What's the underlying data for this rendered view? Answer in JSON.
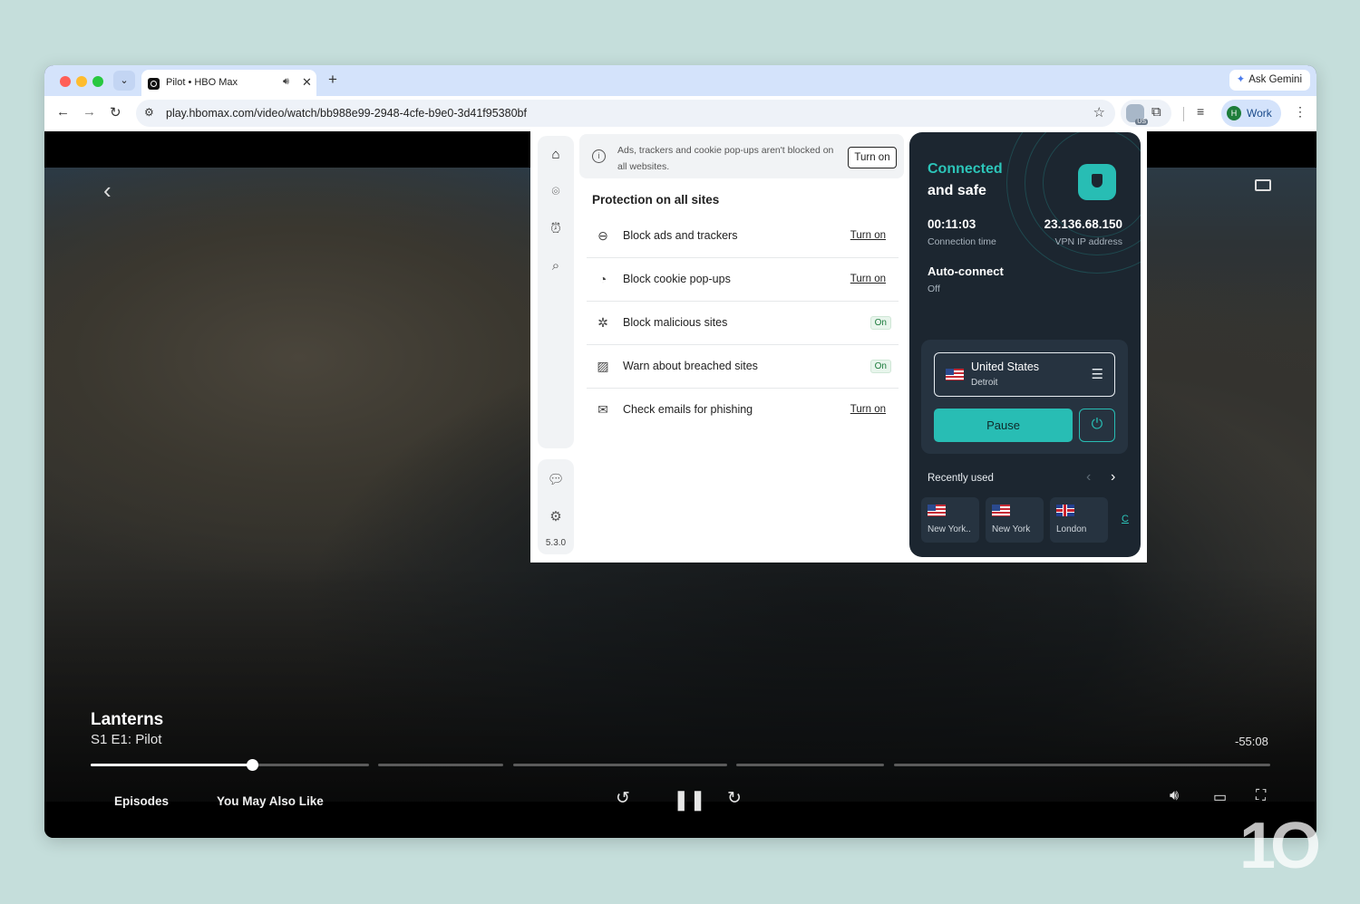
{
  "browser": {
    "tab": {
      "title": "Pilot • HBO Max",
      "audio_icon": "speaker-icon",
      "close_glyph": "✕"
    },
    "new_tab_glyph": "+",
    "ask_gemini": "Ask Gemini",
    "url": "play.hbomax.com/video/watch/bb988e99-2948-4cfe-b9e0-3d41f95380bf",
    "extension_badge": "US",
    "profile": {
      "initial": "H",
      "label": "Work"
    }
  },
  "player": {
    "show_title": "Lanterns",
    "episode": "S1 E1:  Pilot",
    "time_remaining": "-55:08",
    "progress_fraction": 0.13,
    "bottom_links": {
      "episodes": "Episodes",
      "you_may_also_like": "You May Also Like"
    }
  },
  "vpn_popup": {
    "version": "5.3.0",
    "notice": {
      "text": "Ads, trackers and cookie pop-ups aren't blocked on all websites.",
      "button": "Turn on"
    },
    "protection_title": "Protection on all sites",
    "protection_items": [
      {
        "label": "Block ads and trackers",
        "status": "Turn on",
        "icon": "minus-circle-icon"
      },
      {
        "label": "Block cookie pop-ups",
        "status": "Turn on",
        "icon": "cookie-icon"
      },
      {
        "label": "Block malicious sites",
        "status": "On",
        "icon": "bug-icon"
      },
      {
        "label": "Warn about breached sites",
        "status": "On",
        "icon": "breach-image-icon"
      },
      {
        "label": "Check emails for phishing",
        "status": "Turn on",
        "icon": "mail-icon"
      }
    ],
    "status_line1": "Connected",
    "status_line2": "and safe",
    "connection_time": {
      "value": "00:11:03",
      "label": "Connection time"
    },
    "vpn_ip": {
      "value": "23.136.68.150",
      "label": "VPN IP address"
    },
    "auto_connect": {
      "title": "Auto-connect",
      "value": "Off"
    },
    "location": {
      "country": "United States",
      "city": "Detroit"
    },
    "pause_label": "Pause",
    "recently_used_title": "Recently used",
    "recent": [
      {
        "label": "New York..",
        "flag": "us"
      },
      {
        "label": "New York",
        "flag": "us"
      },
      {
        "label": "London",
        "flag": "uk"
      }
    ],
    "recent_more": "C",
    "accent_color": "#28bdb4",
    "panel_color": "#1c2630"
  }
}
